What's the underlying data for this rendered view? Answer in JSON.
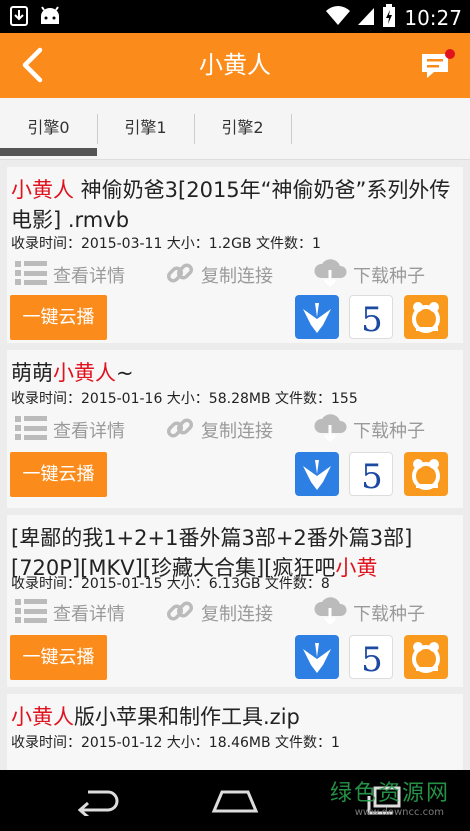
{
  "status": {
    "time": "10:27"
  },
  "header": {
    "title": "小黄人"
  },
  "tabs": [
    {
      "label": "引擎0"
    },
    {
      "label": "引擎1"
    },
    {
      "label": "引擎2"
    }
  ],
  "actions": {
    "detail": "查看详情",
    "copy": "复制连接",
    "download": "下载种子",
    "play": "一键云播"
  },
  "items": [
    {
      "name_hl": "小黄人",
      "name_rest": " 神偷奶爸3[2015年“神偷奶爸”系列外传电影] .rmvb",
      "meta": "收录时间：2015-03-11 大小：1.2GB 文件数：1"
    },
    {
      "name_pre": "萌萌",
      "name_hl": "小黄人",
      "name_rest": "~",
      "meta": "收录时间：2015-01-16 大小：58.28MB 文件数：155"
    },
    {
      "name_pre": "[卑鄙的我1+2+1番外篇3部+2番外篇3部][720P][MKV][珍藏大合集][疯狂吧",
      "name_hl": "小黄",
      "meta": "收录时间：2015-01-15 大小：6.13GB 文件数：8"
    },
    {
      "name_hl": "小黄人",
      "name_rest": "版小苹果和制作工具.zip",
      "meta": "收录时间：2015-01-12 大小：18.46MB 文件数：1"
    }
  ],
  "watermark": {
    "main": "绿色资源网",
    "sub": "www.downcc.com"
  },
  "colors": {
    "accent": "#fb8c1c",
    "highlight": "#e0121e"
  },
  "icons": [
    "download-icon",
    "android-icon",
    "wifi-icon",
    "signal-icon",
    "battery-icon",
    "back-arrow-icon",
    "message-icon",
    "list-icon",
    "link-icon",
    "cloud-download-icon",
    "xunlei-icon",
    "baidu-5-icon",
    "uc-icon",
    "nav-back-icon",
    "nav-home-icon",
    "nav-recent-icon"
  ]
}
